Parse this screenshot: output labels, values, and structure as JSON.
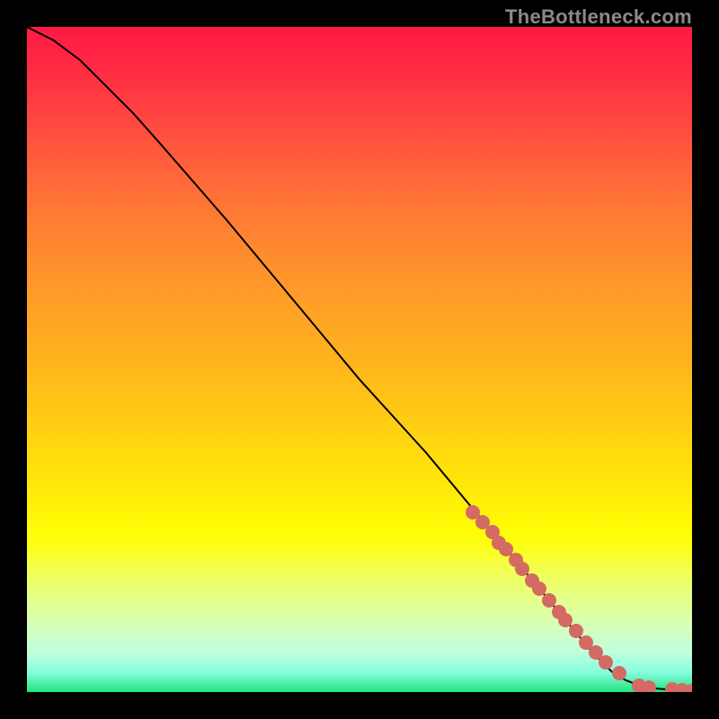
{
  "watermark": "TheBottleneck.com",
  "colors": {
    "background": "#000000",
    "curve": "#000000",
    "point": "#d46a64"
  },
  "chart_data": {
    "type": "line",
    "title": "",
    "xlabel": "",
    "ylabel": "",
    "xlim": [
      0,
      100
    ],
    "ylim": [
      0,
      100
    ],
    "series": [
      {
        "name": "curve",
        "x": [
          0,
          4,
          8,
          12,
          16,
          20,
          30,
          40,
          50,
          60,
          70,
          80,
          85,
          88,
          90,
          92,
          94,
          96,
          98,
          100
        ],
        "y": [
          100,
          98,
          95,
          91,
          87,
          82.5,
          71,
          59,
          47,
          36,
          24,
          12,
          6,
          3,
          1.8,
          1.0,
          0.6,
          0.4,
          0.25,
          0.2
        ]
      }
    ],
    "points": {
      "name": "highlighted-points",
      "x": [
        67,
        68.5,
        70,
        71,
        72,
        73.5,
        74.5,
        76,
        77,
        78.5,
        80,
        81,
        82.5,
        84,
        85.5,
        87,
        89,
        92,
        93.5,
        97,
        98.5,
        100
      ],
      "y": [
        27,
        25.5,
        24,
        22.5,
        21.5,
        19.8,
        18.5,
        16.8,
        15.5,
        13.8,
        12,
        10.8,
        9.2,
        7.5,
        6,
        4.5,
        2.8,
        1.0,
        0.7,
        0.35,
        0.25,
        0.2
      ]
    }
  }
}
